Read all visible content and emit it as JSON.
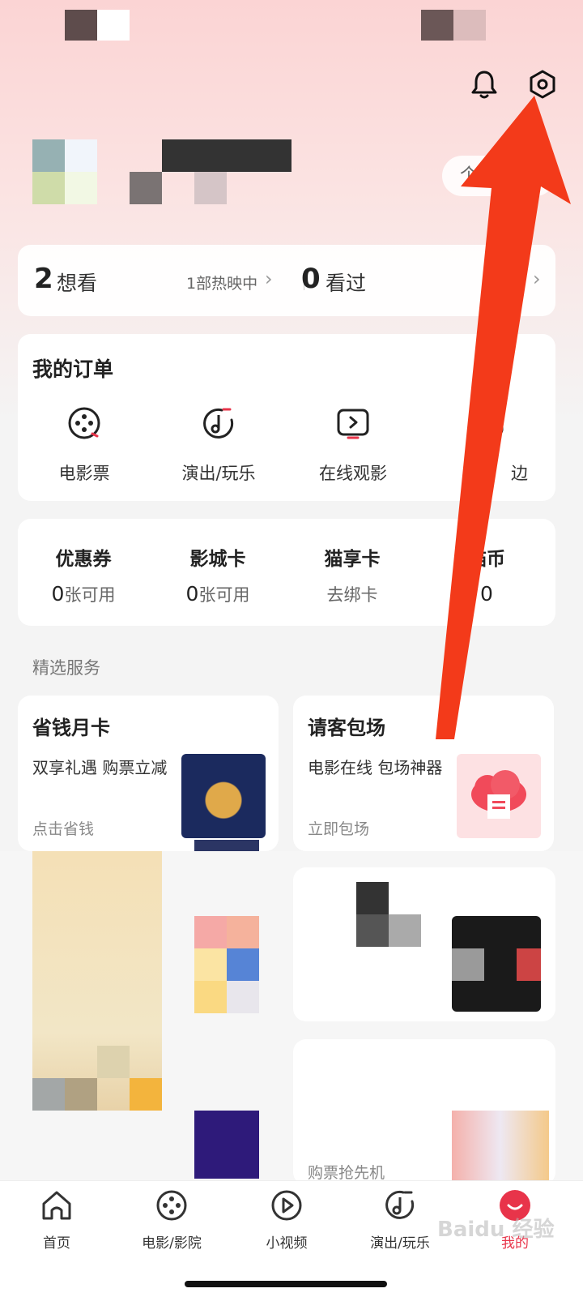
{
  "header": {
    "profile_button_text": "个",
    "bell_icon": "bell-icon",
    "settings_icon": "settings-gear-icon"
  },
  "watch_stats": {
    "want_count": "2",
    "want_label": "想看",
    "hot_showing": "1部热映中",
    "watched_count": "0",
    "watched_label": "看过"
  },
  "orders": {
    "title": "我的订单",
    "items": [
      {
        "label": "电影票",
        "icon": "film-reel-icon"
      },
      {
        "label": "演出/玩乐",
        "icon": "music-note-icon"
      },
      {
        "label": "在线观影",
        "icon": "play-screen-icon"
      },
      {
        "label": "边",
        "icon": "merch-icon"
      }
    ]
  },
  "assets": [
    {
      "title": "优惠券",
      "num": "0",
      "unit": "张可用"
    },
    {
      "title": "影城卡",
      "num": "0",
      "unit": "张可用"
    },
    {
      "title": "猫享卡",
      "num": "",
      "unit": "去绑卡"
    },
    {
      "title": "猫币",
      "num": "0",
      "unit": ""
    }
  ],
  "services": {
    "section_label": "精选服务",
    "left": {
      "title": "省钱月卡",
      "desc": "双享礼遇 购票立减",
      "cta": "点击省钱"
    },
    "right": {
      "title": "请客包场",
      "desc": "电影在线 包场神器",
      "cta": "立即包场"
    },
    "bottom_right_text": "购票抢先机"
  },
  "tabbar": [
    {
      "label": "首页",
      "icon": "home-icon"
    },
    {
      "label": "电影/影院",
      "icon": "film-reel-icon"
    },
    {
      "label": "小视频",
      "icon": "play-circle-icon"
    },
    {
      "label": "演出/玩乐",
      "icon": "music-note-icon"
    },
    {
      "label": "我的",
      "icon": "avatar-icon"
    }
  ],
  "colors": {
    "accent": "#e8344a",
    "arrow": "#f33a1a"
  },
  "watermark": "Baidu 经验"
}
